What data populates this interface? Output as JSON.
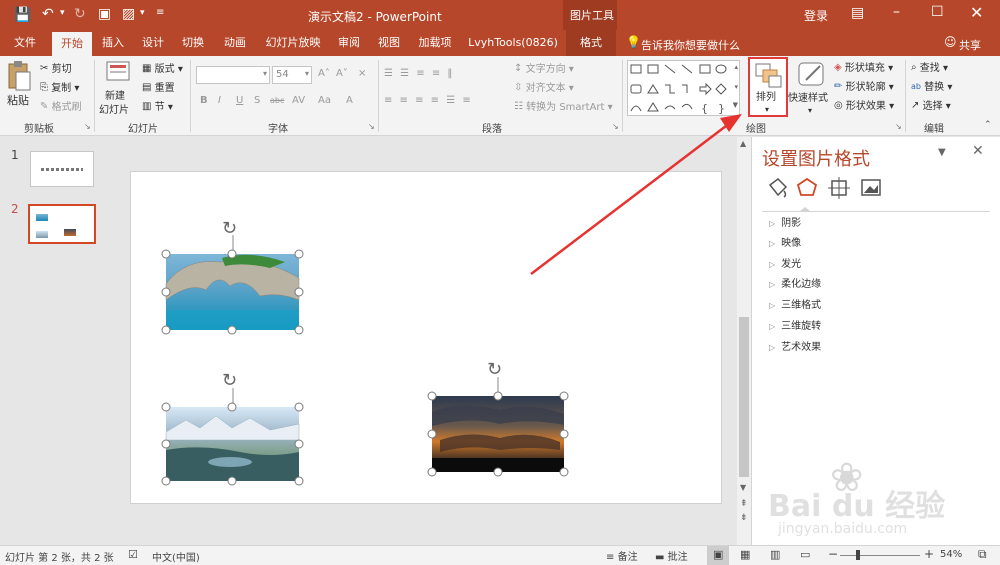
{
  "title_bar": {
    "doc_title": "演示文稿2 - PowerPoint",
    "context_tool": "图片工具",
    "login": "登录"
  },
  "tabs": [
    "文件",
    "开始",
    "插入",
    "设计",
    "切换",
    "动画",
    "幻灯片放映",
    "审阅",
    "视图",
    "加载项",
    "LvyhTools(0826)",
    "格式"
  ],
  "active_tab": "开始",
  "tell_me": "告诉我你想要做什么",
  "share": "共享",
  "ribbon": {
    "clipboard": {
      "paste": "粘贴",
      "cut": "剪切",
      "copy": "复制",
      "format_painter": "格式刷",
      "label": "剪贴板"
    },
    "slides": {
      "new_slide_1": "新建",
      "new_slide_2": "幻灯片",
      "layout": "版式",
      "reset": "重置",
      "section": "节",
      "label": "幻灯片"
    },
    "font": {
      "font_size": "54",
      "label": "字体",
      "bold": "B",
      "italic": "I",
      "underline": "U",
      "strike": "S",
      "shadow": "abc",
      "spacing": "AV",
      "case": "Aa",
      "color": "A"
    },
    "paragraph": {
      "text_direction": "文字方向",
      "align_text": "对齐文本",
      "smartart": "转换为 SmartArt",
      "label": "段落"
    },
    "drawing": {
      "arrange": "排列",
      "quick_styles": "快速样式",
      "shape_fill": "形状填充",
      "shape_outline": "形状轮廓",
      "shape_effects": "形状效果",
      "label": "绘图"
    },
    "editing": {
      "find": "查找",
      "replace": "替换",
      "select": "选择",
      "label": "编辑"
    }
  },
  "thumbnails": [
    {
      "number": "1"
    },
    {
      "number": "2"
    }
  ],
  "format_pane": {
    "title": "设置图片格式",
    "sections": [
      "阴影",
      "映像",
      "发光",
      "柔化边缘",
      "三维格式",
      "三维旋转",
      "艺术效果"
    ]
  },
  "status": {
    "slide_info": "幻灯片 第 2 张，共 2 张",
    "language": "中文(中国)",
    "notes": "备注",
    "comments": "批注",
    "zoom": "54%"
  },
  "watermark": {
    "brand": "Bai du 经验",
    "url": "jingyan.baidu.com"
  },
  "colors": {
    "accent": "#b7472a",
    "arrow": "#e8322f",
    "highlight": "#e03a3a"
  }
}
